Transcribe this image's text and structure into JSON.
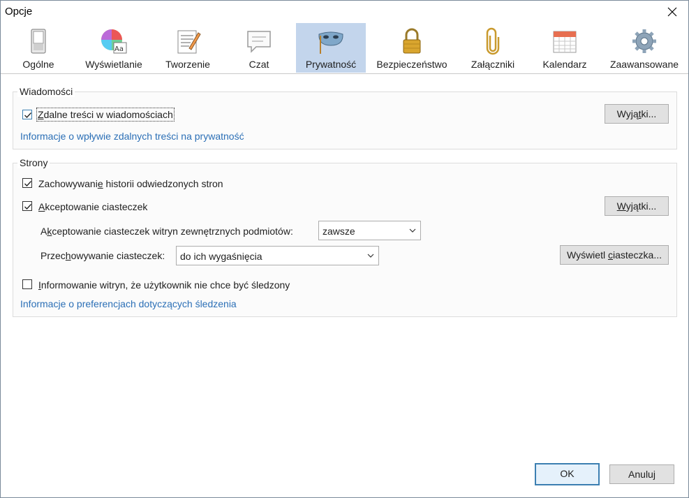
{
  "window": {
    "title": "Opcje"
  },
  "toolbar": {
    "tabs": [
      {
        "label": "Ogólne",
        "icon": "switch-icon"
      },
      {
        "label": "Wyświetlanie",
        "icon": "color-wheel-icon"
      },
      {
        "label": "Tworzenie",
        "icon": "document-pencil-icon"
      },
      {
        "label": "Czat",
        "icon": "speech-bubble-icon"
      },
      {
        "label": "Prywatność",
        "icon": "mask-icon",
        "selected": true
      },
      {
        "label": "Bezpieczeństwo",
        "icon": "padlock-icon"
      },
      {
        "label": "Załączniki",
        "icon": "paperclip-icon"
      },
      {
        "label": "Kalendarz",
        "icon": "calendar-icon"
      },
      {
        "label": "Zaawansowane",
        "icon": "gear-icon"
      }
    ]
  },
  "messages": {
    "title": "Wiadomości",
    "remote_content": {
      "label_first": "Z",
      "label_rest": "dalne treści w wiadomościach",
      "checked": true
    },
    "exceptions_button": {
      "before": "Wyją",
      "ul": "t",
      "after": "ki..."
    },
    "info_link": "Informacje o wpływie zdalnych treści na prywatność"
  },
  "sites": {
    "title": "Strony",
    "history": {
      "before": "Zachowywani",
      "ul": "e",
      "after": " historii odwiedzonych stron",
      "checked": true
    },
    "cookies": {
      "ul": "A",
      "after": "kceptowanie ciasteczek",
      "checked": true
    },
    "cookies_exceptions_button": {
      "ul": "W",
      "after": "yjątki..."
    },
    "third_party": {
      "before": "A",
      "ul": "k",
      "after": "ceptowanie ciasteczek witryn zewnętrznych podmiotów:",
      "value": "zawsze"
    },
    "keep": {
      "before": "Przec",
      "ul": "h",
      "after": "owywanie ciasteczek:",
      "value": "do ich wygaśnięcia"
    },
    "show_cookies_button": {
      "before": "Wyświetl ",
      "ul": "c",
      "after": "iasteczka..."
    },
    "dnt": {
      "ul": "I",
      "after": "nformowanie witryn, że użytkownik nie chce być śledzony",
      "checked": false
    },
    "tracking_link": "Informacje o preferencjach dotyczących śledzenia"
  },
  "footer": {
    "ok": "OK",
    "cancel": "Anuluj"
  },
  "colors": {
    "accent": "#3c7fb1",
    "link": "#2b6fb6",
    "selected_tab": "#c3d5ec"
  }
}
